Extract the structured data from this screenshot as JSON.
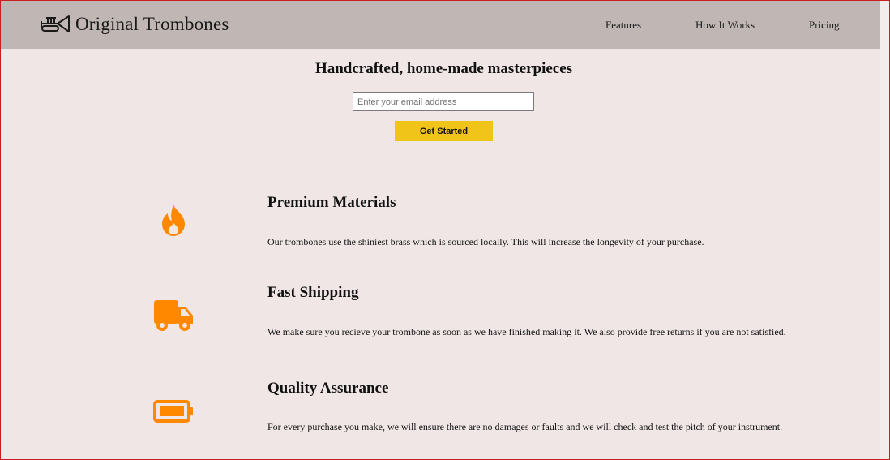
{
  "header": {
    "brand": "Original Trombones",
    "nav": [
      "Features",
      "How It Works",
      "Pricing"
    ]
  },
  "hero": {
    "title": "Handcrafted, home-made masterpieces",
    "email_placeholder": "Enter your email address",
    "cta_label": "Get Started"
  },
  "features": [
    {
      "icon": "fire-icon",
      "title": "Premium Materials",
      "description": "Our trombones use the shiniest brass which is sourced locally. This will increase the longevity of your purchase."
    },
    {
      "icon": "truck-icon",
      "title": "Fast Shipping",
      "description": "We make sure you recieve your trombone as soon as we have finished making it. We also provide free returns if you are not satisfied."
    },
    {
      "icon": "battery-full-icon",
      "title": "Quality Assurance",
      "description": "For every purchase you make, we will ensure there are no damages or faults and we will check and test the pitch of your instrument."
    }
  ],
  "colors": {
    "page_background": "#f0e6e6",
    "header_background": "#c0b6b4",
    "button": "#f0c419",
    "icon_accent": "#ff8800",
    "window_border": "#c81e1e"
  }
}
